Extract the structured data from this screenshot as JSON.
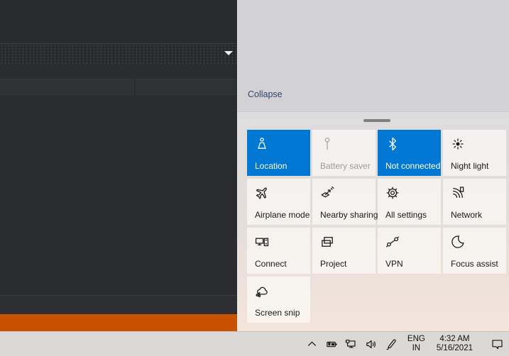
{
  "app_window": {
    "accent_bar_color": "#c85200"
  },
  "action_center": {
    "collapse_label": "Collapse",
    "colors": {
      "accent_tile": "#0078d4",
      "panel_top": "#d2d2d4",
      "panel_bottom": "#f3e5da"
    },
    "tiles": [
      {
        "id": "location",
        "label": "Location",
        "icon": "location-icon",
        "state": "on"
      },
      {
        "id": "battery-saver",
        "label": "Battery saver",
        "icon": "battery-saver-icon",
        "state": "disabled"
      },
      {
        "id": "bluetooth",
        "label": "Not connected",
        "icon": "bluetooth-icon",
        "state": "on"
      },
      {
        "id": "night-light",
        "label": "Night light",
        "icon": "night-light-icon",
        "state": "off"
      },
      {
        "id": "airplane-mode",
        "label": "Airplane mode",
        "icon": "airplane-icon",
        "state": "off"
      },
      {
        "id": "nearby-sharing",
        "label": "Nearby sharing",
        "icon": "nearby-sharing-icon",
        "state": "off"
      },
      {
        "id": "all-settings",
        "label": "All settings",
        "icon": "settings-gear-icon",
        "state": "off"
      },
      {
        "id": "network",
        "label": "Network",
        "icon": "network-icon",
        "state": "off"
      },
      {
        "id": "connect",
        "label": "Connect",
        "icon": "connect-icon",
        "state": "off"
      },
      {
        "id": "project",
        "label": "Project",
        "icon": "project-icon",
        "state": "off"
      },
      {
        "id": "vpn",
        "label": "VPN",
        "icon": "vpn-icon",
        "state": "off"
      },
      {
        "id": "focus-assist",
        "label": "Focus assist",
        "icon": "focus-assist-icon",
        "state": "off"
      },
      {
        "id": "screen-snip",
        "label": "Screen snip",
        "icon": "screen-snip-icon",
        "state": "off"
      }
    ]
  },
  "taskbar": {
    "tray_icons": [
      "show-hidden-icons",
      "battery-charging",
      "ethernet",
      "volume",
      "windows-ink-pen"
    ],
    "language": {
      "line1": "ENG",
      "line2": "IN"
    },
    "clock": {
      "time": "4:32 AM",
      "date": "5/16/2021"
    },
    "notifications_icon": "action-center-bubble"
  }
}
